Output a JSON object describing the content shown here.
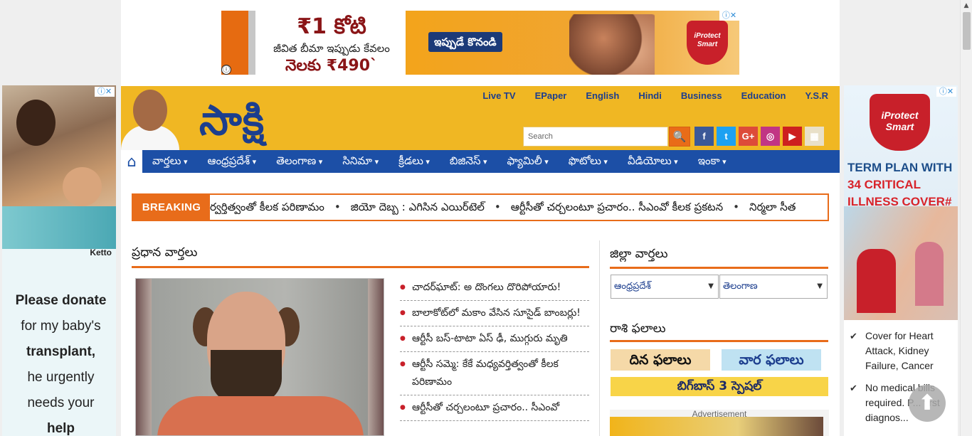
{
  "top_ad": {
    "amount": "₹1 కోటి",
    "line2": "జీవిత బీమా ఇప్పుడు కేవలం",
    "line3": "నెలకు ₹490`",
    "cta": "ఇప్పుడే కొనండి",
    "brand": "iProtect Smart",
    "info_icon": "ⓘ",
    "close_icon": "ⓘ✕"
  },
  "left_ad": {
    "brand": "Ketto",
    "close_icon": "ⓘ✕",
    "line1": "Please donate",
    "line2": "for my baby's",
    "line3": "transplant,",
    "line4": "he urgently",
    "line5": "needs your",
    "line6": "help"
  },
  "right_ad": {
    "close_icon": "ⓘ✕",
    "brand": "iProtect Smart",
    "headline1": "TERM PLAN WITH",
    "headline2": "34 CRITICAL",
    "headline3": "ILLNESS COVER#",
    "bullet1": "Cover for Heart Attack, Kidney Failure, Cancer",
    "bullet2": "No medical bills required. P... first diagnos..."
  },
  "header": {
    "logo": "సాక్షి",
    "top_links": [
      "Live TV",
      "EPaper",
      "English",
      "Hindi",
      "Business",
      "Education",
      "Y.S.R"
    ],
    "search_placeholder": "Search",
    "search_icon": "🔍",
    "social": [
      {
        "name": "facebook",
        "glyph": "f",
        "color": "#3b5998"
      },
      {
        "name": "twitter",
        "glyph": "t",
        "color": "#1da1f2"
      },
      {
        "name": "google-plus",
        "glyph": "G+",
        "color": "#dd4b39"
      },
      {
        "name": "instagram",
        "glyph": "◎",
        "color": "#c13584"
      },
      {
        "name": "youtube",
        "glyph": "▶",
        "color": "#cd201f"
      },
      {
        "name": "calendar",
        "glyph": "▦",
        "color": "#e9e0c8"
      }
    ]
  },
  "nav": {
    "home_icon": "⌂",
    "items": [
      "వార్తలు",
      "ఆంధ్రప్రదేశ్",
      "తెలంగాణ",
      "సినిమా",
      "క్రీడలు",
      "బిజినెస్",
      "ఫ్యామిలీ",
      "ఫొటోలు",
      "వీడియోలు",
      "ఇంకా"
    ]
  },
  "breaking": {
    "label": "BREAKING",
    "items": [
      "ర్వర్తిత్వంతో కీలక పరిణామం",
      "జియో దెబ్బ : ఎగిసిన ఎయిర్‌టెల్",
      "ఆర్టీసీతో చర్చలంటూ ప్రచారం.. సీఎంవో కీలక ప్రకటన",
      "నిర్మలా సీత"
    ]
  },
  "main": {
    "heading": "ప్రధాన వార్తలు",
    "news": [
      "చాదర్‌ఘాట్‌: అ దొంగలు దొరిపోయారు!",
      "బాలాకోట్‌లో మకాం వేసిన సూసైడ్‌ బాంబర్లు!",
      "ఆర్టీసీ బస్‌-టాటా ఏస్‌ ఢీ, ముగ్గురు మృతి",
      "ఆర్టీసీ సమ్మె: కేకే మధ్యవర్తిత్వంతో కీలక పరిణామం",
      "ఆర్టీసీతో చర్చలంటూ ప్రచారం.. సీఎంవో"
    ]
  },
  "right_col": {
    "district_heading": "జిల్లా వార్తలు",
    "district_select_1": "ఆంధ్రప్రదేశ్",
    "district_select_2": "తెలంగాణ",
    "select_arrow": "▼",
    "rasi_heading": "రాశి ఫలాలు",
    "daily": "దిన ఫలాలు",
    "weekly": "వార ఫలాలు",
    "bigboss": "బిగ్‌బాస్‌ 3 స్పెషల్‌",
    "adv_label": "Advertisement"
  },
  "scroll_top_icon": "⬆",
  "scroll_up_icon": "▲"
}
